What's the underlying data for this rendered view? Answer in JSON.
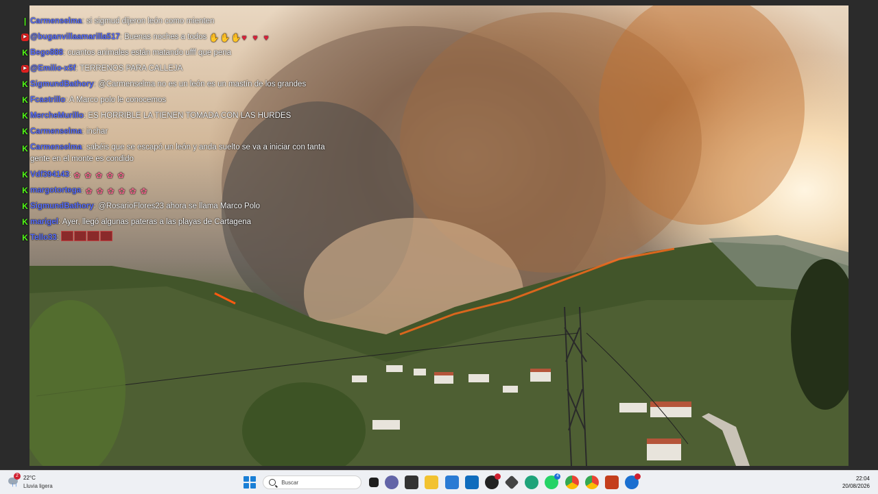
{
  "chat": {
    "messages": [
      {
        "platform": "kick",
        "user": "Carmenselma",
        "text": "si sigmud dijeron león como mienten"
      },
      {
        "platform": "youtube",
        "user": "@buganvillaamarilla517",
        "text": "Buenas noches a todos"
      },
      {
        "platform": "kick",
        "user": "Bego888",
        "text": "cuantos animales están matando ufff que pena"
      },
      {
        "platform": "youtube",
        "user": "@Emilio-x5f",
        "text": "TERRENOS PARA CALLEJA"
      },
      {
        "platform": "kick",
        "user": "SigmundBathory",
        "text": "@Carmenselma no es un león es un mastín de los grandes"
      },
      {
        "platform": "kick",
        "user": "Fcastrillo",
        "text": "A Marco polo le conocemos"
      },
      {
        "platform": "kick",
        "user": "MercheMurillo",
        "text": "ES HORRIBLE LA TIENEN TOMADA CON LAS HURDES"
      },
      {
        "platform": "kick",
        "user": "Carmenselma",
        "text": "inchar"
      },
      {
        "platform": "kick",
        "user": "Carmenselma",
        "text": "sabéis que se escapó un león y anda suelto se va a iniciar con tanta gente en el monte es condido"
      },
      {
        "platform": "kick",
        "user": "Vdf394143",
        "text": ""
      },
      {
        "platform": "kick",
        "user": "margotortega",
        "text": ""
      },
      {
        "platform": "kick",
        "user": "SigmundBathory",
        "text": "@RosarioFlores23 ahora se llama Marco Polo"
      },
      {
        "platform": "kick",
        "user": "marigel",
        "text": "Ayer, llegó algunas pateras a las playas de Cartagena"
      },
      {
        "platform": "kick",
        "user": "Tello33",
        "text": ""
      }
    ]
  },
  "taskbar": {
    "weather": {
      "temp": "22°C",
      "desc": "Lluvia ligera",
      "badge": "2"
    },
    "search_placeholder": "Buscar",
    "whatsapp_badge": "4",
    "clock": {
      "time": "22:04",
      "date": "20/08/2026"
    }
  }
}
